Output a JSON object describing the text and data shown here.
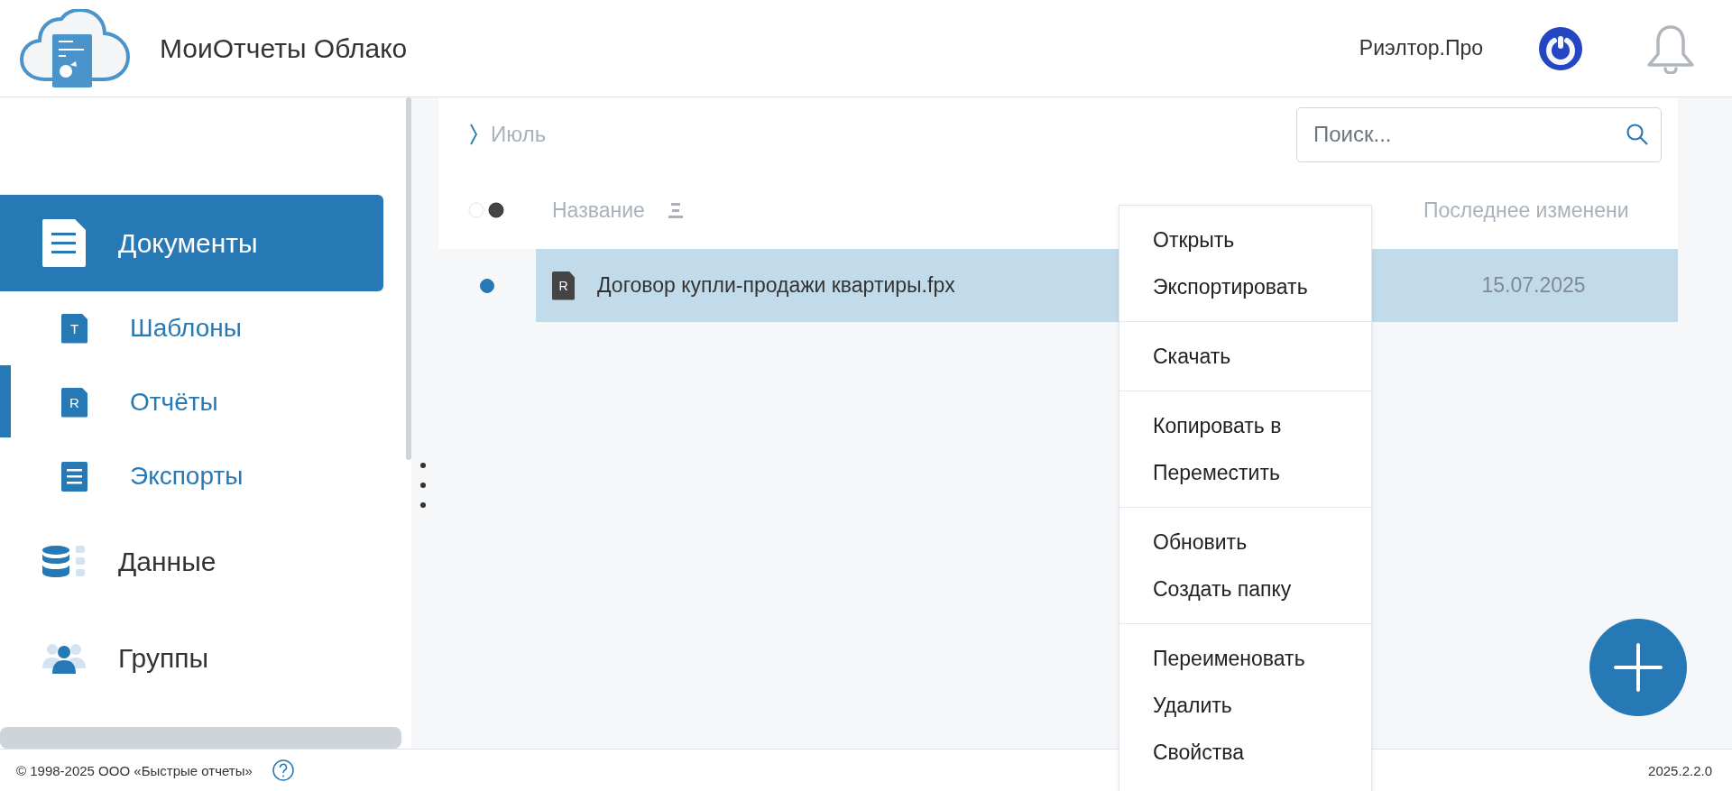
{
  "app": {
    "title": "МоиОтчеты Облако"
  },
  "header": {
    "account": "Риэлтор.Про"
  },
  "sidebar": {
    "items": [
      {
        "label": "Документы",
        "kind": "document",
        "selected": true,
        "children": [
          {
            "label": "Шаблоны",
            "kind": "letter",
            "badge": "T",
            "selected": false
          },
          {
            "label": "Отчёты",
            "kind": "letter",
            "badge": "R",
            "selected": true
          },
          {
            "label": "Экспорты",
            "kind": "list",
            "selected": false
          }
        ]
      },
      {
        "label": "Данные",
        "kind": "database",
        "selected": false
      },
      {
        "label": "Группы",
        "kind": "users",
        "selected": false
      }
    ]
  },
  "breadcrumb": [
    "Июль"
  ],
  "search": {
    "placeholder": "Поиск..."
  },
  "table": {
    "columns": [
      {
        "label": "Название",
        "sortable": true
      },
      {
        "label": "Последнее изменени",
        "sortable": false
      }
    ],
    "rows": [
      {
        "name": "Договор купли-продажи квартиры.fpx",
        "badge": "R",
        "modified": "15.07.2025",
        "selected": true
      }
    ]
  },
  "context_menu": {
    "groups": [
      [
        "Открыть",
        "Экспортировать"
      ],
      [
        "Скачать"
      ],
      [
        "Копировать в",
        "Переместить"
      ],
      [
        "Обновить",
        "Создать папку"
      ],
      [
        "Переименовать",
        "Удалить",
        "Свойства"
      ]
    ]
  },
  "footer": {
    "copyright": "© 1998-2025 ООО «Быстрые отчеты»",
    "version": "2025.2.2.0"
  }
}
